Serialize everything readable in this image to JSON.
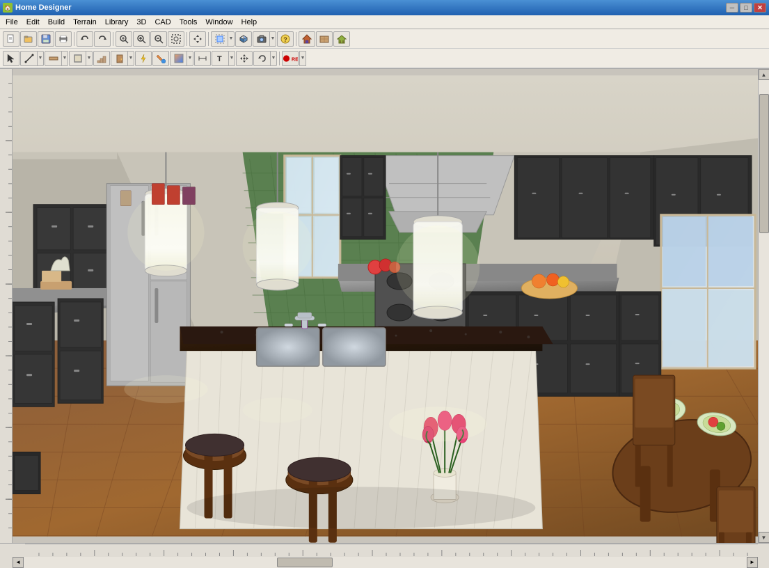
{
  "titlebar": {
    "title": "Home Designer",
    "icon": "🏠",
    "buttons": {
      "minimize": "─",
      "maximize": "□",
      "close": "✕"
    }
  },
  "menubar": {
    "items": [
      "File",
      "Edit",
      "Build",
      "Terrain",
      "Library",
      "3D",
      "CAD",
      "Tools",
      "Window",
      "Help"
    ]
  },
  "toolbar1": {
    "buttons": [
      {
        "name": "new",
        "icon": "📄"
      },
      {
        "name": "open",
        "icon": "📂"
      },
      {
        "name": "save",
        "icon": "💾"
      },
      {
        "name": "print",
        "icon": "🖨"
      },
      {
        "name": "undo",
        "icon": "↩"
      },
      {
        "name": "redo",
        "icon": "↪"
      },
      {
        "name": "zoom-fit",
        "icon": "🔍"
      },
      {
        "name": "zoom-in",
        "icon": "⊕"
      },
      {
        "name": "zoom-out",
        "icon": "⊖"
      },
      {
        "name": "zoom-box",
        "icon": "⊡"
      },
      {
        "name": "pan",
        "icon": "✋"
      },
      {
        "name": "select",
        "icon": "⊹"
      },
      {
        "name": "info",
        "icon": "ℹ"
      },
      {
        "name": "camera",
        "icon": "📷"
      },
      {
        "name": "help",
        "icon": "?"
      },
      {
        "name": "render",
        "icon": "🏠"
      },
      {
        "name": "floor-cam",
        "icon": "🏗"
      },
      {
        "name": "walk",
        "icon": "👣"
      }
    ]
  },
  "toolbar2": {
    "buttons": [
      {
        "name": "select-tool",
        "icon": "↖"
      },
      {
        "name": "draw-line",
        "icon": "╱"
      },
      {
        "name": "draw-wall",
        "icon": "⊟"
      },
      {
        "name": "room",
        "icon": "⬜"
      },
      {
        "name": "stair",
        "icon": "🏗"
      },
      {
        "name": "door",
        "icon": "🚪"
      },
      {
        "name": "window",
        "icon": "⊞"
      },
      {
        "name": "electric",
        "icon": "⚡"
      },
      {
        "name": "paint",
        "icon": "🖌"
      },
      {
        "name": "material",
        "icon": "🎨"
      },
      {
        "name": "dimension",
        "icon": "↔"
      },
      {
        "name": "text",
        "icon": "T"
      },
      {
        "name": "move",
        "icon": "✛"
      },
      {
        "name": "rotate",
        "icon": "↻"
      },
      {
        "name": "rec",
        "icon": "⏺"
      }
    ]
  },
  "scene": {
    "description": "3D Kitchen Interior View"
  },
  "statusbar": {
    "text": ""
  }
}
